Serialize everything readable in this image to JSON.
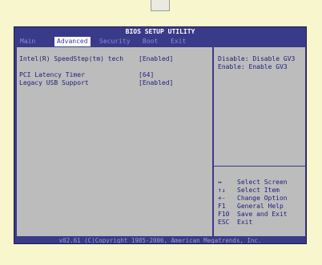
{
  "title": "BIOS SETUP UTILITY",
  "menu": [
    {
      "label": "Main"
    },
    {
      "label": "Advanced"
    },
    {
      "label": "Security"
    },
    {
      "label": "Boot"
    },
    {
      "label": "Exit"
    }
  ],
  "settings": [
    {
      "label": "Intel(R) SpeedStep(tm) tech",
      "value": "[Enabled]"
    },
    {
      "label": "PCI Latency Timer",
      "value": "[64]"
    },
    {
      "label": "Legacy USB Support",
      "value": "[Enabled]"
    }
  ],
  "help": {
    "lines": [
      "Disable: Disable GV3",
      "Enable:  Enable GV3"
    ]
  },
  "keys": [
    {
      "key": "↔",
      "desc": "Select Screen"
    },
    {
      "key": "↑↓",
      "desc": "Select Item"
    },
    {
      "key": "+-",
      "desc": "Change Option"
    },
    {
      "key": "F1",
      "desc": "General Help"
    },
    {
      "key": "F10",
      "desc": "Save and Exit"
    },
    {
      "key": "ESC",
      "desc": "Exit"
    }
  ],
  "footer": "v02.61 (C)Copyright 1985-2006, American Megatrends, Inc.",
  "colors": {
    "page_background": "#f8f6cc",
    "bios_blue": "#3a3a8a",
    "panel_gray": "#bcbcbc",
    "text_blue": "#1e1e7a",
    "menu_inactive": "#8c8cd6"
  }
}
